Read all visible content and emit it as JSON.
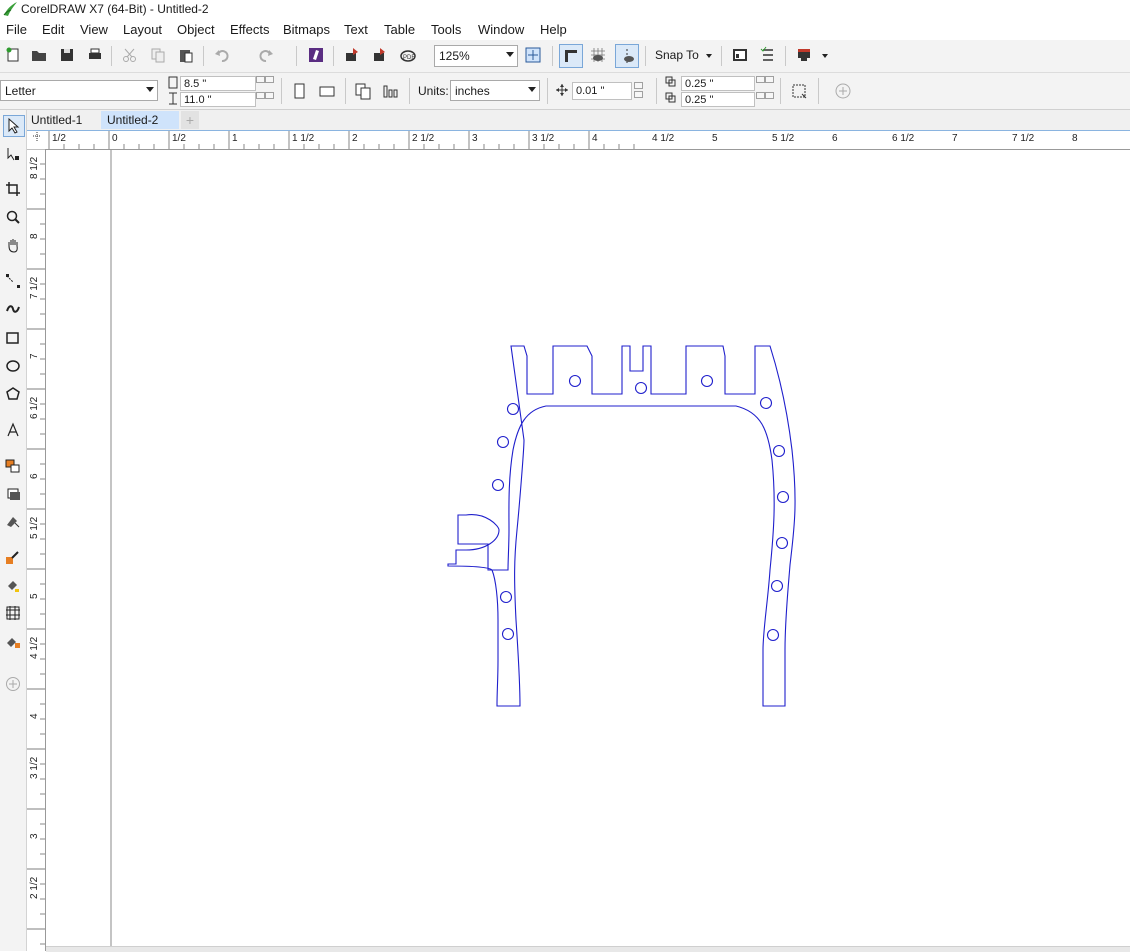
{
  "window": {
    "title": "CorelDRAW X7 (64-Bit) - Untitled-2"
  },
  "menu": [
    "File",
    "Edit",
    "View",
    "Layout",
    "Object",
    "Effects",
    "Bitmaps",
    "Text",
    "Table",
    "Tools",
    "Window",
    "Help"
  ],
  "standard_toolbar": {
    "zoom_level": "125%",
    "snap_to_label": "Snap To"
  },
  "property_bar": {
    "page_size": "Letter",
    "page_width": "8.5 \"",
    "page_height": "11.0 \"",
    "units_label": "Units:",
    "units_value": "inches",
    "nudge": "0.01 \"",
    "dup_x": "0.25 \"",
    "dup_y": "0.25 \""
  },
  "tabs": [
    {
      "label": "Untitled-1",
      "active": false
    },
    {
      "label": "Untitled-2",
      "active": true
    }
  ],
  "toolbox": [
    "pick-tool-icon",
    "shape-tool-icon",
    "crop-tool-icon",
    "zoom-tool-icon",
    "pan-tool-icon",
    "freehand-tool-icon",
    "artistic-media-icon",
    "rectangle-tool-icon",
    "ellipse-tool-icon",
    "polygon-tool-icon",
    "text-tool-icon",
    "parallel-dimension-icon",
    "connector-tool-icon",
    "drop-shadow-tool-icon",
    "transparency-tool-icon",
    "color-eyedropper-icon",
    "interactive-fill-icon",
    "mesh-fill-icon",
    "smart-fill-icon",
    "add-tool-icon"
  ],
  "rulers": {
    "horizontal": [
      "1/2",
      "0",
      "1/2",
      "1",
      "1 1/2",
      "2",
      "2 1/2",
      "3",
      "3 1/2",
      "4",
      "4 1/2",
      "5",
      "5 1/2",
      "6",
      "6 1/2",
      "7",
      "7 1/2",
      "8"
    ],
    "vertical": [
      "8 1/2",
      "8",
      "7 1/2",
      "7",
      "6 1/2",
      "6",
      "5 1/2",
      "5",
      "4 1/2",
      "4",
      "3 1/2",
      "3",
      "2 1/2"
    ]
  },
  "colors": {
    "drawing_stroke": "#1f1fcc",
    "active_tab": "#cfe3fb",
    "toolbar_bg": "#f3f3f3"
  }
}
